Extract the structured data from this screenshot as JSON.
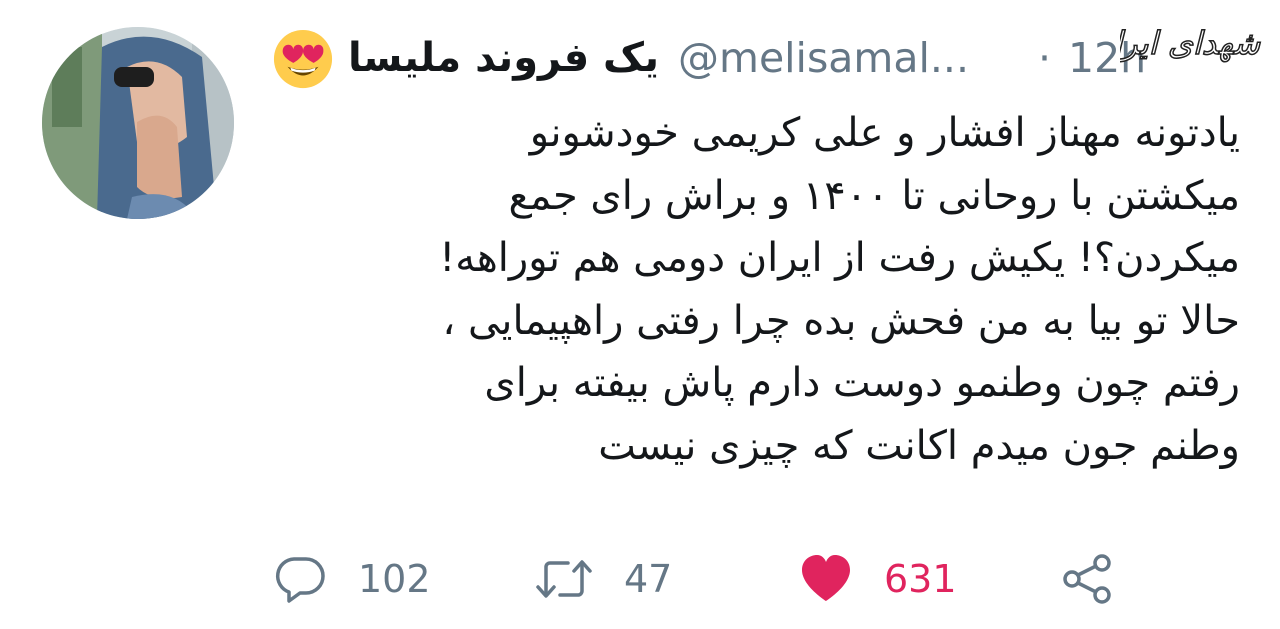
{
  "tweet": {
    "display_name": "یک فروند ملیسا",
    "handle": "@melisamal...",
    "separator": "·",
    "time": "12h",
    "emoji_icon": "heart-eyes-emoji",
    "watermark_text": "شهدای ایران",
    "lines": [
      "یادتونه مهناز افشار و علی کریمی خودشونو",
      "میکشتن با روحانی تا ۱۴۰۰ و براش رای جمع",
      "میکردن؟! یکیش رفت از ایران دومی هم توراهه!",
      "حالا تو بیا به من فحش بده چرا رفتی راهپیمایی ،",
      "رفتم چون وطنمو دوست دارم پاش بیفته برای",
      "وطنم جون میدم اکانت که چیزی نیست"
    ],
    "actions": {
      "replies": "102",
      "retweets": "47",
      "likes": "631"
    }
  },
  "colors": {
    "text": "#14171a",
    "muted": "#657786",
    "like": "#e0245e"
  }
}
